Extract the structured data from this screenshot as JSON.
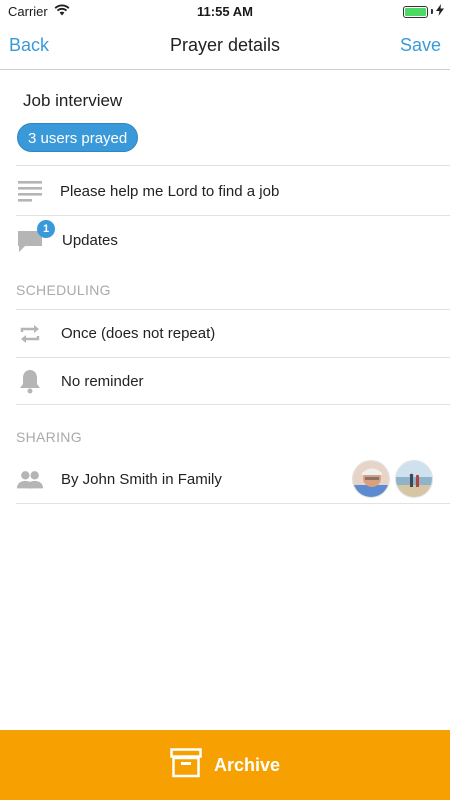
{
  "status_bar": {
    "carrier": "Carrier",
    "time": "11:55 AM"
  },
  "nav": {
    "back_label": "Back",
    "title": "Prayer details",
    "save_label": "Save"
  },
  "prayer": {
    "title": "Job interview",
    "prayed_badge": "3 users prayed"
  },
  "details": {
    "description": "Please help me Lord to find a job",
    "updates_label": "Updates",
    "updates_count": "1"
  },
  "scheduling": {
    "header": "SCHEDULING",
    "repeat": "Once (does not repeat)",
    "reminder": "No reminder"
  },
  "sharing": {
    "header": "SHARING",
    "shared_by": "By John Smith in Family"
  },
  "archive": {
    "label": "Archive"
  },
  "colors": {
    "accent": "#3a9ad9",
    "archive": "#f6a101",
    "icon_gray": "#b5b5b5",
    "section_gray": "#aaaaaa"
  },
  "icons": [
    "wifi-icon",
    "charging-bolt-icon",
    "description-lines-icon",
    "comment-icon",
    "repeat-icon",
    "bell-icon",
    "group-icon",
    "archive-box-icon"
  ]
}
